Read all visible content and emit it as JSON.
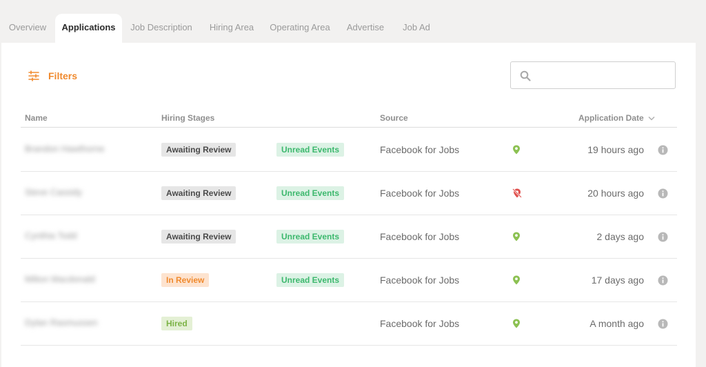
{
  "tabs": [
    {
      "label": "Overview",
      "active": false
    },
    {
      "label": "Applications",
      "active": true
    },
    {
      "label": "Job Description",
      "active": false
    },
    {
      "label": "Hiring Area",
      "active": false
    },
    {
      "label": "Operating Area",
      "active": false
    },
    {
      "label": "Advertise",
      "active": false
    },
    {
      "label": "Job Ad",
      "active": false
    }
  ],
  "toolbar": {
    "filters_label": "Filters",
    "search_placeholder": "",
    "search_value": ""
  },
  "table": {
    "headers": {
      "name": "Name",
      "hiring_stages": "Hiring Stages",
      "source": "Source",
      "application_date": "Application Date"
    },
    "rows": [
      {
        "name": "Brandon Hawthorne",
        "stage": "Awaiting Review",
        "stage_type": "awaiting",
        "events": "Unread Events",
        "source": "Facebook for Jobs",
        "location_status": "in-area",
        "date": "19 hours ago"
      },
      {
        "name": "Steve Cassidy",
        "stage": "Awaiting Review",
        "stage_type": "awaiting",
        "events": "Unread Events",
        "source": "Facebook for Jobs",
        "location_status": "out-of-area",
        "date": "20 hours ago"
      },
      {
        "name": "Cynthia Todd",
        "stage": "Awaiting Review",
        "stage_type": "awaiting",
        "events": "Unread Events",
        "source": "Facebook for Jobs",
        "location_status": "in-area",
        "date": "2 days ago"
      },
      {
        "name": "Milton Macdonald",
        "stage": "In Review",
        "stage_type": "inreview",
        "events": "Unread Events",
        "source": "Facebook for Jobs",
        "location_status": "in-area",
        "date": "17 days ago"
      },
      {
        "name": "Dylan Rasmussen",
        "stage": "Hired",
        "stage_type": "hired",
        "events": "",
        "source": "Facebook for Jobs",
        "location_status": "in-area",
        "date": "A month ago"
      }
    ]
  },
  "colors": {
    "accent": "#f08a2e",
    "pin_ok": "#8cc152",
    "pin_bad": "#e0504d",
    "info_icon": "#b8b8b8"
  },
  "icons": {
    "filters": "sliders-icon",
    "search": "search-icon",
    "sort": "chevron-down-icon",
    "location_ok": "map-pin-icon",
    "location_bad": "map-pin-off-icon",
    "info": "info-icon"
  }
}
